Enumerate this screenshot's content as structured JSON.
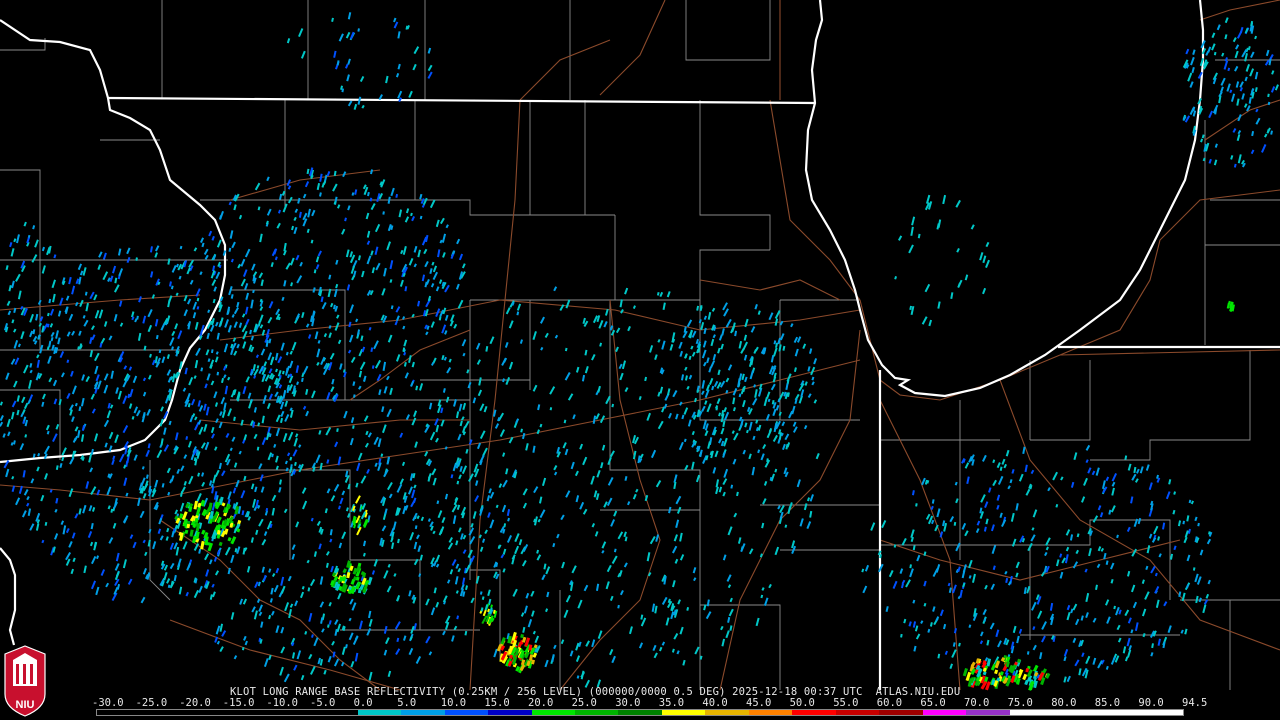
{
  "product": {
    "caption": "KLOT LONG RANGE BASE REFLECTIVITY (0.25KM / 256 LEVEL) (000000/0000 0.5 DEG) 2025-12-18 00:37 UTC  ATLAS.NIU.EDU"
  },
  "logo": {
    "text": "NIU",
    "colors": {
      "red": "#c8102e",
      "white": "#ffffff"
    }
  },
  "colorbar": {
    "labels": [
      "-30.0",
      "-25.0",
      "-20.0",
      "-15.0",
      "-10.0",
      "-5.0",
      "0.0",
      "5.0",
      "10.0",
      "15.0",
      "20.0",
      "25.0",
      "30.0",
      "35.0",
      "40.0",
      "45.0",
      "50.0",
      "55.0",
      "60.0",
      "65.0",
      "70.0",
      "75.0",
      "80.0",
      "85.0",
      "90.0",
      "94.5"
    ],
    "colors": [
      "#000000",
      "#000000",
      "#000000",
      "#000000",
      "#000000",
      "#000000",
      "#00c8c8",
      "#00a0e6",
      "#0050ff",
      "#0000c8",
      "#00e600",
      "#00b400",
      "#008200",
      "#ffff00",
      "#e6b400",
      "#ff8200",
      "#ff0000",
      "#c80000",
      "#a00000",
      "#ff00ff",
      "#9632c8",
      "#ffffff",
      "#ffffff",
      "#ffffff",
      "#ffffff",
      "#ffffff"
    ]
  },
  "map_colors": {
    "state_border": "#ffffff",
    "county_border": "#8a8a8a",
    "highway": "#8b4a2b",
    "background": "#000000"
  }
}
